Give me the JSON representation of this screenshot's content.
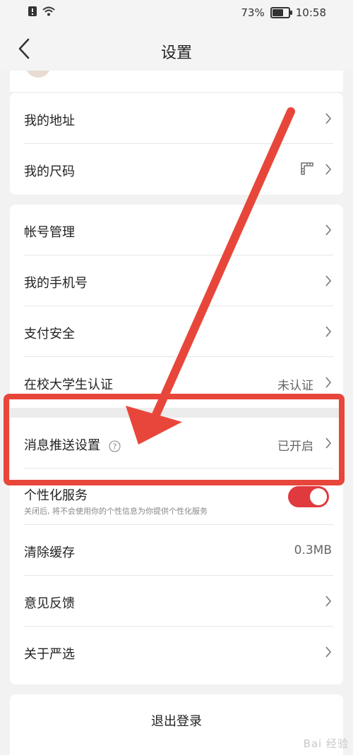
{
  "status_bar": {
    "battery_percent": "73%",
    "battery_level": 0.73,
    "time": "10:58"
  },
  "header": {
    "title": "设置"
  },
  "card1": {
    "items": [
      {
        "label": "我的地址"
      },
      {
        "label": "我的尺码"
      }
    ]
  },
  "card2": {
    "items": [
      {
        "label": "帐号管理"
      },
      {
        "label": "我的手机号"
      },
      {
        "label": "支付安全"
      },
      {
        "label": "在校大学生认证",
        "value": "未认证"
      },
      {
        "label": "消息推送设置",
        "value": "已开启"
      },
      {
        "label": "个性化服务",
        "sub": "关闭后, 将不会使用你的个性信息为你提供个性化服务",
        "toggle_on": true
      },
      {
        "label": "清除缓存",
        "value": "0.3MB"
      },
      {
        "label": "意见反馈"
      },
      {
        "label": "关于严选"
      }
    ]
  },
  "logout": {
    "label": "退出登录"
  },
  "watermark": "Bai 经验",
  "colors": {
    "accent_red": "#e0393e",
    "annotation_red": "#e8463a"
  }
}
